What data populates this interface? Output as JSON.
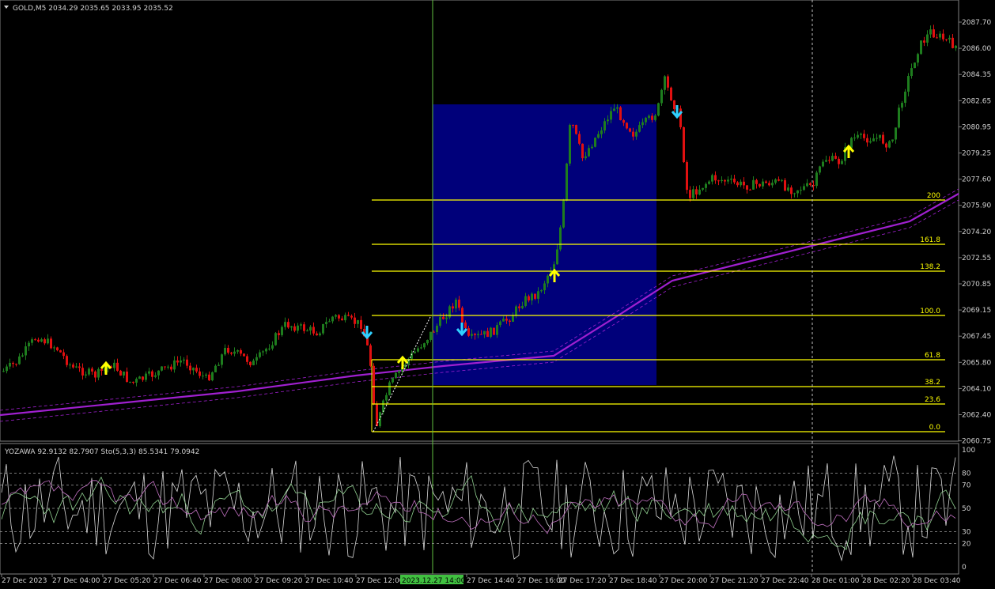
{
  "header": {
    "symbol": "GOLD,M5",
    "ohlc": "2034.29 2035.65 2033.95 2035.52",
    "menu_icon": "triangle-down-icon"
  },
  "indicator": {
    "yozawa": "YOZAWA 92.9132 82.7907",
    "stoch": "Sto(5,3,3) 85.5341 79.0942",
    "levels": [
      "100",
      "80",
      "70",
      "50",
      "30",
      "20",
      "0"
    ]
  },
  "price_axis": [
    "2087.70",
    "2086.00",
    "2084.35",
    "2082.65",
    "2080.95",
    "2079.25",
    "2077.60",
    "2075.90",
    "2074.20",
    "2072.55",
    "2070.85",
    "2069.15",
    "2067.45",
    "2065.80",
    "2064.10",
    "2062.40",
    "2060.75"
  ],
  "time_axis": [
    "27 Dec 2023",
    "27 Dec 04:00",
    "27 Dec 05:20",
    "27 Dec 06:40",
    "27 Dec 08:00",
    "27 Dec 09:20",
    "27 Dec 10:40",
    "27 Dec 12:00",
    "2023.12.27 14:00",
    "27 Dec 14:40",
    "27 Dec 16:00",
    "27 Dec 17:20",
    "27 Dec 18:40",
    "27 Dec 20:00",
    "27 Dec 21:20",
    "27 Dec 22:40",
    "28 Dec 01:00",
    "28 Dec 02:20",
    "28 Dec 03:40"
  ],
  "fib_levels": [
    "200",
    "161.8",
    "138.2",
    "100.0",
    "61.8",
    "38.2",
    "23.6",
    "0.0"
  ],
  "colors": {
    "bull": "#1e7d1e",
    "bear": "#e01010",
    "ma": "#a020d0",
    "fib": "#ffff00",
    "box": "#00007a",
    "crosshair": "#60c040",
    "time_highlight": "#40c040",
    "arrow_up": "#ffff00",
    "arrow_down": "#30d0ff"
  }
}
